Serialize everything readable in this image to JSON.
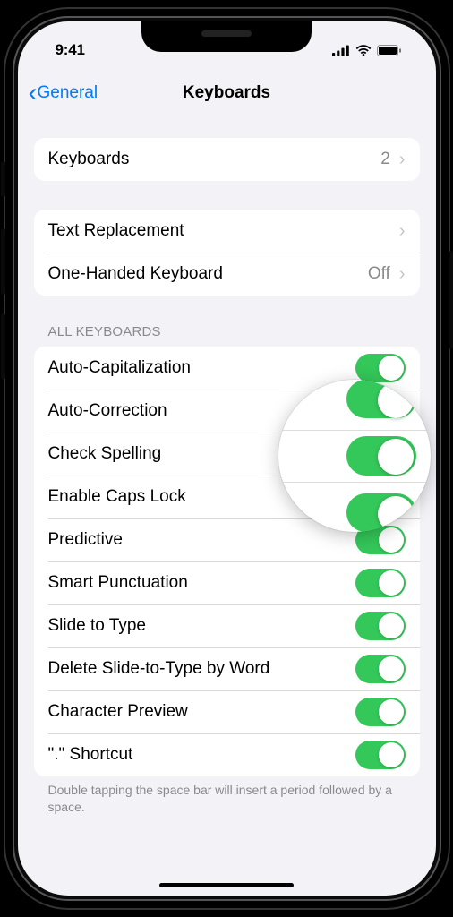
{
  "status": {
    "time": "9:41"
  },
  "nav": {
    "back_label": "General",
    "title": "Keyboards"
  },
  "group1": {
    "keyboards": {
      "label": "Keyboards",
      "value": "2"
    }
  },
  "group2": {
    "text_replacement": {
      "label": "Text Replacement"
    },
    "one_handed": {
      "label": "One-Handed Keyboard",
      "value": "Off"
    }
  },
  "section_header": "ALL KEYBOARDS",
  "toggles": [
    {
      "label": "Auto-Capitalization"
    },
    {
      "label": "Auto-Correction"
    },
    {
      "label": "Check Spelling"
    },
    {
      "label": "Enable Caps Lock"
    },
    {
      "label": "Predictive"
    },
    {
      "label": "Smart Punctuation"
    },
    {
      "label": "Slide to Type"
    },
    {
      "label": "Delete Slide-to-Type by Word"
    },
    {
      "label": "Character Preview"
    },
    {
      "label": "\".\" Shortcut"
    }
  ],
  "footer": "Double tapping the space bar will insert a period followed by a space."
}
